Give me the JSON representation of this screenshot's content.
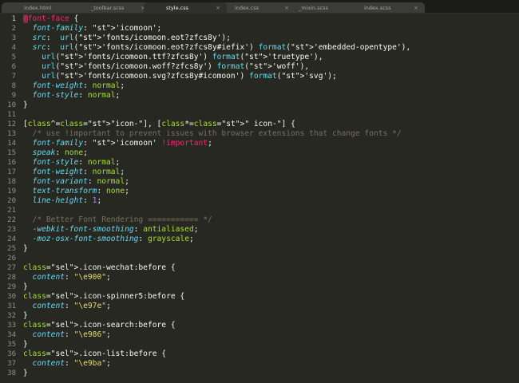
{
  "tabs": [
    {
      "label": "index.html",
      "close": "×",
      "active": false
    },
    {
      "label": "_toolbar.scss",
      "close": "×",
      "active": false
    },
    {
      "label": "style.css",
      "close": "×",
      "active": true
    },
    {
      "label": "index.css",
      "close": "×",
      "active": false
    },
    {
      "label": "_mixin.scss",
      "close": "×",
      "active": false
    },
    {
      "label": "index.scss",
      "close": "×",
      "active": false
    }
  ],
  "code": {
    "lines": [
      {
        "n": "1",
        "t": "@font-face {"
      },
      {
        "n": "2",
        "t": "  font-family: 'icomoon';"
      },
      {
        "n": "3",
        "t": "  src:  url('fonts/icomoon.eot?zfcs8y');"
      },
      {
        "n": "4",
        "t": "  src:  url('fonts/icomoon.eot?zfcs8y#iefix') format('embedded-opentype'),"
      },
      {
        "n": "5",
        "t": "    url('fonts/icomoon.ttf?zfcs8y') format('truetype'),"
      },
      {
        "n": "6",
        "t": "    url('fonts/icomoon.woff?zfcs8y') format('woff'),"
      },
      {
        "n": "7",
        "t": "    url('fonts/icomoon.svg?zfcs8y#icomoon') format('svg');"
      },
      {
        "n": "8",
        "t": "  font-weight: normal;"
      },
      {
        "n": "9",
        "t": "  font-style: normal;"
      },
      {
        "n": "10",
        "t": "}"
      },
      {
        "n": "11",
        "t": ""
      },
      {
        "n": "12",
        "t": "[class^=\"icon-\"], [class*=\" icon-\"] {"
      },
      {
        "n": "13",
        "t": "  /* use !important to prevent issues with browser extensions that change fonts */"
      },
      {
        "n": "14",
        "t": "  font-family: 'icomoon' !important;"
      },
      {
        "n": "15",
        "t": "  speak: none;"
      },
      {
        "n": "16",
        "t": "  font-style: normal;"
      },
      {
        "n": "17",
        "t": "  font-weight: normal;"
      },
      {
        "n": "18",
        "t": "  font-variant: normal;"
      },
      {
        "n": "19",
        "t": "  text-transform: none;"
      },
      {
        "n": "20",
        "t": "  line-height: 1;"
      },
      {
        "n": "21",
        "t": ""
      },
      {
        "n": "22",
        "t": "  /* Better Font Rendering =========== */"
      },
      {
        "n": "23",
        "t": "  -webkit-font-smoothing: antialiased;"
      },
      {
        "n": "24",
        "t": "  -moz-osx-font-smoothing: grayscale;"
      },
      {
        "n": "25",
        "t": "}"
      },
      {
        "n": "26",
        "t": ""
      },
      {
        "n": "27",
        "t": ".icon-wechat:before {"
      },
      {
        "n": "28",
        "t": "  content: \"\\e900\";"
      },
      {
        "n": "29",
        "t": "}"
      },
      {
        "n": "30",
        "t": ".icon-spinner5:before {"
      },
      {
        "n": "31",
        "t": "  content: \"\\e97e\";"
      },
      {
        "n": "32",
        "t": "}"
      },
      {
        "n": "33",
        "t": ".icon-search:before {"
      },
      {
        "n": "34",
        "t": "  content: \"\\e986\";"
      },
      {
        "n": "35",
        "t": "}"
      },
      {
        "n": "36",
        "t": ".icon-list:before {"
      },
      {
        "n": "37",
        "t": "  content: \"\\e9ba\";"
      },
      {
        "n": "38",
        "t": "}"
      }
    ]
  }
}
